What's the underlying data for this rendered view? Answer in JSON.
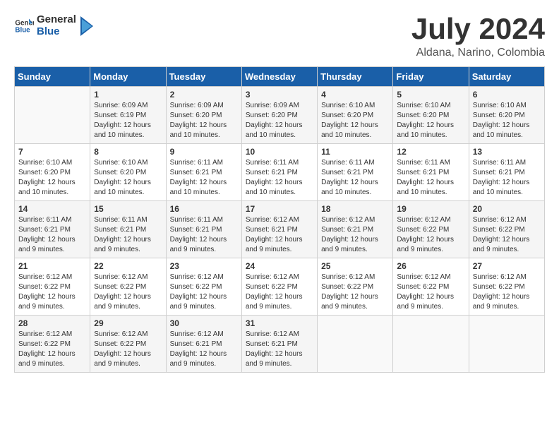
{
  "logo": {
    "general": "General",
    "blue": "Blue"
  },
  "title": "July 2024",
  "subtitle": "Aldana, Narino, Colombia",
  "weekdays": [
    "Sunday",
    "Monday",
    "Tuesday",
    "Wednesday",
    "Thursday",
    "Friday",
    "Saturday"
  ],
  "weeks": [
    [
      {
        "day": "",
        "info": ""
      },
      {
        "day": "1",
        "info": "Sunrise: 6:09 AM\nSunset: 6:19 PM\nDaylight: 12 hours\nand 10 minutes."
      },
      {
        "day": "2",
        "info": "Sunrise: 6:09 AM\nSunset: 6:20 PM\nDaylight: 12 hours\nand 10 minutes."
      },
      {
        "day": "3",
        "info": "Sunrise: 6:09 AM\nSunset: 6:20 PM\nDaylight: 12 hours\nand 10 minutes."
      },
      {
        "day": "4",
        "info": "Sunrise: 6:10 AM\nSunset: 6:20 PM\nDaylight: 12 hours\nand 10 minutes."
      },
      {
        "day": "5",
        "info": "Sunrise: 6:10 AM\nSunset: 6:20 PM\nDaylight: 12 hours\nand 10 minutes."
      },
      {
        "day": "6",
        "info": "Sunrise: 6:10 AM\nSunset: 6:20 PM\nDaylight: 12 hours\nand 10 minutes."
      }
    ],
    [
      {
        "day": "7",
        "info": "Sunrise: 6:10 AM\nSunset: 6:20 PM\nDaylight: 12 hours\nand 10 minutes."
      },
      {
        "day": "8",
        "info": "Sunrise: 6:10 AM\nSunset: 6:20 PM\nDaylight: 12 hours\nand 10 minutes."
      },
      {
        "day": "9",
        "info": "Sunrise: 6:11 AM\nSunset: 6:21 PM\nDaylight: 12 hours\nand 10 minutes."
      },
      {
        "day": "10",
        "info": "Sunrise: 6:11 AM\nSunset: 6:21 PM\nDaylight: 12 hours\nand 10 minutes."
      },
      {
        "day": "11",
        "info": "Sunrise: 6:11 AM\nSunset: 6:21 PM\nDaylight: 12 hours\nand 10 minutes."
      },
      {
        "day": "12",
        "info": "Sunrise: 6:11 AM\nSunset: 6:21 PM\nDaylight: 12 hours\nand 10 minutes."
      },
      {
        "day": "13",
        "info": "Sunrise: 6:11 AM\nSunset: 6:21 PM\nDaylight: 12 hours\nand 10 minutes."
      }
    ],
    [
      {
        "day": "14",
        "info": "Sunrise: 6:11 AM\nSunset: 6:21 PM\nDaylight: 12 hours\nand 9 minutes."
      },
      {
        "day": "15",
        "info": "Sunrise: 6:11 AM\nSunset: 6:21 PM\nDaylight: 12 hours\nand 9 minutes."
      },
      {
        "day": "16",
        "info": "Sunrise: 6:11 AM\nSunset: 6:21 PM\nDaylight: 12 hours\nand 9 minutes."
      },
      {
        "day": "17",
        "info": "Sunrise: 6:12 AM\nSunset: 6:21 PM\nDaylight: 12 hours\nand 9 minutes."
      },
      {
        "day": "18",
        "info": "Sunrise: 6:12 AM\nSunset: 6:21 PM\nDaylight: 12 hours\nand 9 minutes."
      },
      {
        "day": "19",
        "info": "Sunrise: 6:12 AM\nSunset: 6:22 PM\nDaylight: 12 hours\nand 9 minutes."
      },
      {
        "day": "20",
        "info": "Sunrise: 6:12 AM\nSunset: 6:22 PM\nDaylight: 12 hours\nand 9 minutes."
      }
    ],
    [
      {
        "day": "21",
        "info": "Sunrise: 6:12 AM\nSunset: 6:22 PM\nDaylight: 12 hours\nand 9 minutes."
      },
      {
        "day": "22",
        "info": "Sunrise: 6:12 AM\nSunset: 6:22 PM\nDaylight: 12 hours\nand 9 minutes."
      },
      {
        "day": "23",
        "info": "Sunrise: 6:12 AM\nSunset: 6:22 PM\nDaylight: 12 hours\nand 9 minutes."
      },
      {
        "day": "24",
        "info": "Sunrise: 6:12 AM\nSunset: 6:22 PM\nDaylight: 12 hours\nand 9 minutes."
      },
      {
        "day": "25",
        "info": "Sunrise: 6:12 AM\nSunset: 6:22 PM\nDaylight: 12 hours\nand 9 minutes."
      },
      {
        "day": "26",
        "info": "Sunrise: 6:12 AM\nSunset: 6:22 PM\nDaylight: 12 hours\nand 9 minutes."
      },
      {
        "day": "27",
        "info": "Sunrise: 6:12 AM\nSunset: 6:22 PM\nDaylight: 12 hours\nand 9 minutes."
      }
    ],
    [
      {
        "day": "28",
        "info": "Sunrise: 6:12 AM\nSunset: 6:22 PM\nDaylight: 12 hours\nand 9 minutes."
      },
      {
        "day": "29",
        "info": "Sunrise: 6:12 AM\nSunset: 6:22 PM\nDaylight: 12 hours\nand 9 minutes."
      },
      {
        "day": "30",
        "info": "Sunrise: 6:12 AM\nSunset: 6:21 PM\nDaylight: 12 hours\nand 9 minutes."
      },
      {
        "day": "31",
        "info": "Sunrise: 6:12 AM\nSunset: 6:21 PM\nDaylight: 12 hours\nand 9 minutes."
      },
      {
        "day": "",
        "info": ""
      },
      {
        "day": "",
        "info": ""
      },
      {
        "day": "",
        "info": ""
      }
    ]
  ]
}
